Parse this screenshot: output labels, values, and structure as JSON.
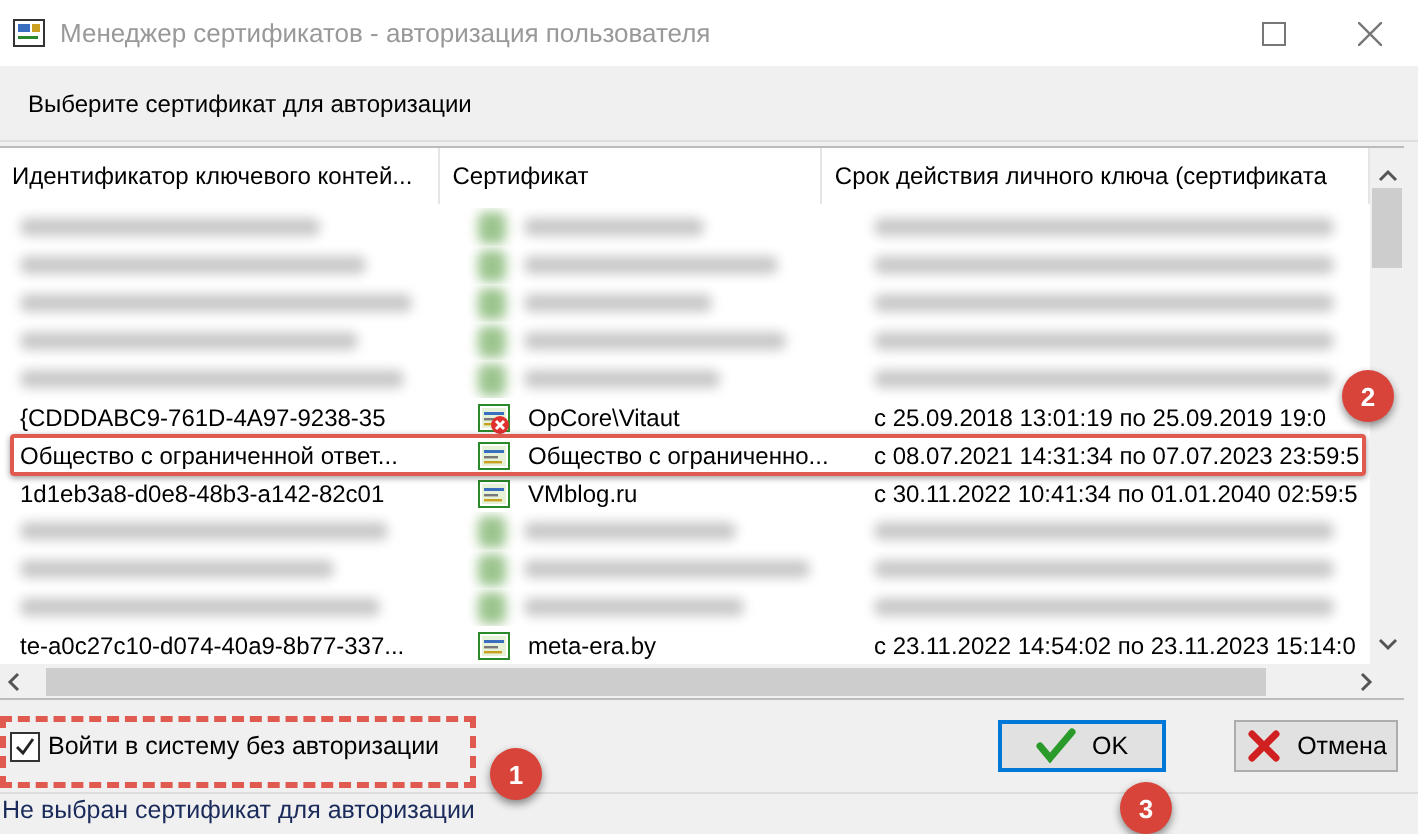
{
  "window": {
    "title": "Менеджер сертификатов - авторизация пользователя"
  },
  "prompt": "Выберите сертификат для авторизации",
  "table": {
    "columns": [
      "Идентификатор ключевого контей...",
      "Сертификат",
      "Срок действия личного ключа (сертификата"
    ],
    "rows": [
      {
        "kind": "blurred"
      },
      {
        "kind": "blurred"
      },
      {
        "kind": "blurred"
      },
      {
        "kind": "blurred"
      },
      {
        "kind": "blurred"
      },
      {
        "kind": "entry",
        "container": "{CDDDABC9-761D-4A97-9238-35",
        "certificate": "OpCore\\Vitaut",
        "validity": "с 25.09.2018 13:01:19 по 25.09.2019 19:0",
        "revoked": true
      },
      {
        "kind": "entry",
        "container": "Общество с ограниченной ответ...",
        "certificate": "Общество с ограниченно...",
        "validity": "с 08.07.2021 14:31:34 по 07.07.2023 23:59:5",
        "revoked": false
      },
      {
        "kind": "entry",
        "container": "1d1eb3a8-d0e8-48b3-a142-82c01",
        "certificate": "VMblog.ru",
        "validity": "с 30.11.2022 10:41:34 по 01.01.2040 02:59:5",
        "revoked": false
      },
      {
        "kind": "blurred"
      },
      {
        "kind": "blurred"
      },
      {
        "kind": "blurred"
      },
      {
        "kind": "entry",
        "container": "te-a0c27c10-d074-40a9-8b77-337...",
        "certificate": "meta-era.by",
        "validity": "с 23.11.2022 14:54:02 по 23.11.2023 15:14:0",
        "revoked": false
      }
    ]
  },
  "login_without_auth": {
    "label": "Войти в систему без авторизации",
    "checked": true
  },
  "buttons": [
    {
      "kind": "ok",
      "label": "OK",
      "default": true
    },
    {
      "kind": "cancel",
      "label": "Отмена",
      "default": false
    }
  ],
  "status_bar": "Не выбран сертификат для авторизации",
  "annotations": [
    {
      "kind": "checkbox",
      "label": "1"
    },
    {
      "kind": "row",
      "label": "2"
    },
    {
      "kind": "ok",
      "label": "3"
    }
  ]
}
